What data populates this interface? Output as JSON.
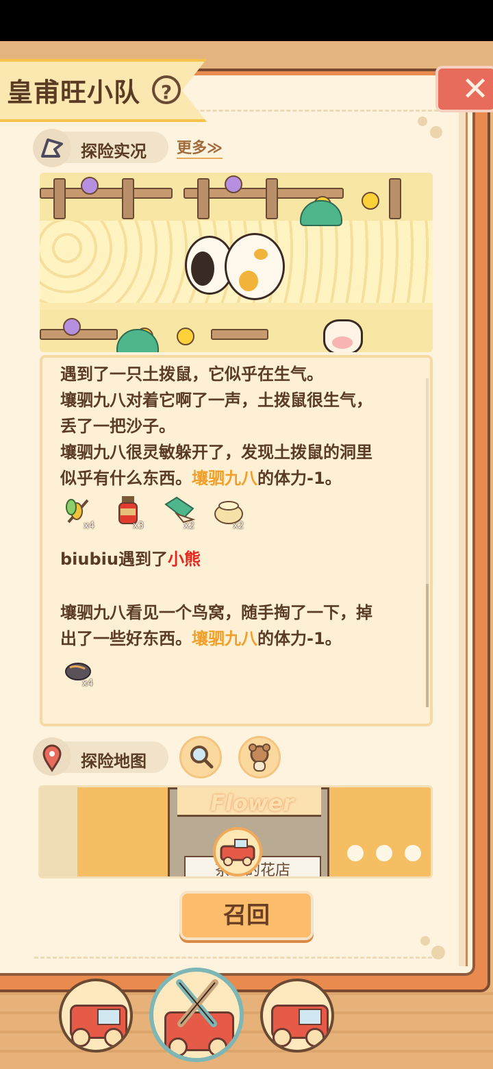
{
  "header": {
    "team_name": "皇甫旺小队",
    "help_label": "?",
    "close_label": "✕"
  },
  "expedition_live": {
    "label": "探险实况",
    "more_link": "更多≫"
  },
  "log": {
    "lines": [
      {
        "text": "遇到了一只土拨鼠，它似乎在生气。"
      },
      {
        "text": "壤驷九八对着它啊了一声，土拨鼠很生气，"
      },
      {
        "text": "丢了一把沙子。"
      },
      {
        "text": "壤驷九八很灵敏躲开了，发现土拨鼠的洞里"
      },
      {
        "prefix": "似乎有什么东西。",
        "highlight": "壤驷九八",
        "suffix": "的体力-1。"
      }
    ],
    "rewards_1": [
      {
        "icon": "wheat-icon",
        "qty": "x4"
      },
      {
        "icon": "jam-jar-icon",
        "qty": "x3"
      },
      {
        "icon": "green-gem-icon",
        "qty": "x2"
      },
      {
        "icon": "honey-pot-icon",
        "qty": "x2"
      }
    ],
    "encounter": {
      "prefix": "biubiu遇到了",
      "highlight": "小熊"
    },
    "lines_2": [
      {
        "text": "壤驷九八看见一个鸟窝，随手掏了一下，掉"
      },
      {
        "prefix": "出了一些好东西。",
        "highlight": "壤驷九八",
        "suffix": "的体力-1。"
      }
    ],
    "rewards_2": [
      {
        "icon": "pinecone-icon",
        "qty": "x4"
      }
    ]
  },
  "expedition_map": {
    "label": "探险地图",
    "shop_sign": "Flower",
    "shop_name": "茶小的花店"
  },
  "actions": {
    "recall_label": "召回"
  },
  "colors": {
    "accent_orange": "#f0a02a",
    "highlight_red": "#e2281e",
    "text_brown": "#5a3b24",
    "page_bg": "#fdf3de"
  }
}
